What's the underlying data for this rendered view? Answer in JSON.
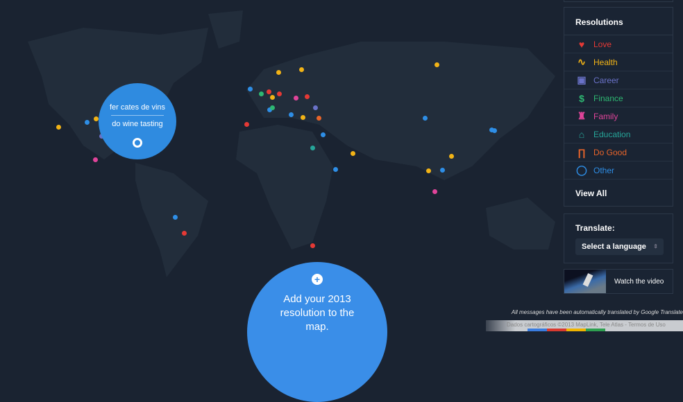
{
  "bubble": {
    "original": "fer cates de vins",
    "translated": "do wine tasting"
  },
  "add_button": {
    "plus": "+",
    "label": "Add your 2013 resolution to the map."
  },
  "resolutions": {
    "title": "Resolutions",
    "items": [
      {
        "label": "Love",
        "icon": "heart-icon",
        "glyph": "♥",
        "color": "#e53935"
      },
      {
        "label": "Health",
        "icon": "heartbeat-icon",
        "glyph": "∿",
        "color": "#f2b316"
      },
      {
        "label": "Career",
        "icon": "laptop-icon",
        "glyph": "▣",
        "color": "#6a72c8"
      },
      {
        "label": "Finance",
        "icon": "dollar-icon",
        "glyph": "$",
        "color": "#2eb872"
      },
      {
        "label": "Family",
        "icon": "family-icon",
        "glyph": "♜",
        "color": "#e0449a"
      },
      {
        "label": "Education",
        "icon": "graduation-cap-icon",
        "glyph": "⌂",
        "color": "#26a69a"
      },
      {
        "label": "Do Good",
        "icon": "binoculars-icon",
        "glyph": "∏",
        "color": "#e8642a"
      },
      {
        "label": "Other",
        "icon": "circle-icon",
        "glyph": "◯",
        "color": "#2e8ee6"
      }
    ],
    "view_all": "View All"
  },
  "translate": {
    "label": "Translate:",
    "select": "Select a language"
  },
  "video": {
    "label": "Watch the video"
  },
  "footer": {
    "note": "All messages have been automatically translated by Google Translate",
    "attribution": "Dados cartográficos ©2013 MapLink, Tele Atlas - Termos de Uso"
  }
}
